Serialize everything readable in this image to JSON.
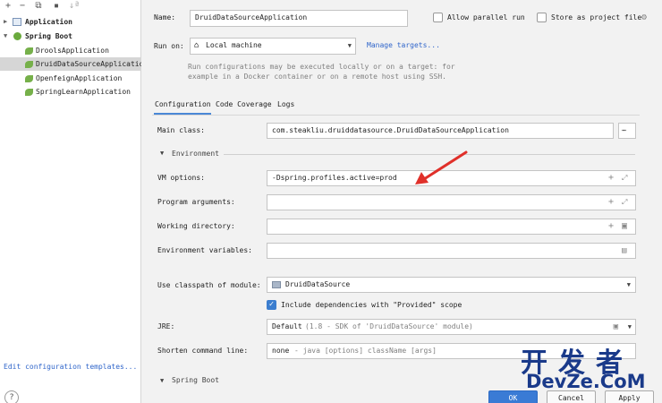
{
  "tree": {
    "items": [
      {
        "label": "Application",
        "icon": "app-config-icon",
        "expanded": false,
        "level": 0
      },
      {
        "label": "Spring Boot",
        "icon": "spring-boot-icon",
        "expanded": true,
        "level": 0
      },
      {
        "label": "DroolsApplication",
        "icon": "spring-leaf-icon",
        "level": 1
      },
      {
        "label": "DruidDataSourceApplication",
        "icon": "spring-leaf-icon",
        "level": 1,
        "selected": true
      },
      {
        "label": "OpenfeignApplication",
        "icon": "spring-leaf-icon",
        "level": 1
      },
      {
        "label": "SpringLearnApplication",
        "icon": "spring-leaf-icon",
        "level": 1
      }
    ],
    "edit_templates": "Edit configuration templates...",
    "help": "?"
  },
  "toolbar": {
    "add": "+",
    "remove": "−",
    "copy": "⧉",
    "folder": "▪",
    "sort": "↓ª"
  },
  "header": {
    "name_label": "Name:",
    "name_value": "DruidDataSourceApplication",
    "allow_parallel_label": "Allow parallel run",
    "store_project_label": "Store as project file",
    "run_on_label": "Run on:",
    "run_on_value": "Local machine",
    "manage_targets": "Manage targets...",
    "hint_line1": "Run configurations may be executed locally or on a target: for",
    "hint_line2": "example in a Docker container or on a remote host using SSH."
  },
  "tabs": [
    "Configuration",
    "Code Coverage",
    "Logs"
  ],
  "config": {
    "main_class_label": "Main class:",
    "main_class_value": "com.steakliu.druiddatasource.DruidDataSourceApplication",
    "environment_section": "Environment",
    "vm_options_label": "VM options:",
    "vm_options_value": "-Dspring.profiles.active=prod",
    "program_args_label": "Program arguments:",
    "working_dir_label": "Working directory:",
    "env_vars_label": "Environment variables:",
    "classpath_label": "Use classpath of module:",
    "classpath_value": "DruidDataSource",
    "include_provided_label": "Include dependencies with \"Provided\" scope",
    "include_provided_checked": true,
    "jre_label": "JRE:",
    "jre_value": "Default",
    "jre_hint": "(1.8 - SDK of 'DruidDataSource' module)",
    "shorten_label": "Shorten command line:",
    "shorten_value": "none",
    "shorten_hint": "- java [options] className [args]",
    "spring_boot_section": "Spring Boot"
  },
  "buttons": {
    "ok": "OK",
    "cancel": "Cancel",
    "apply": "Apply"
  },
  "watermark": {
    "chinese": "开发者",
    "english": "DevZe.CoM"
  },
  "colors": {
    "accent": "#3a7bd5",
    "link": "#2f65ca",
    "arrow": "#e0302a",
    "selection": "#d6d6d6"
  }
}
